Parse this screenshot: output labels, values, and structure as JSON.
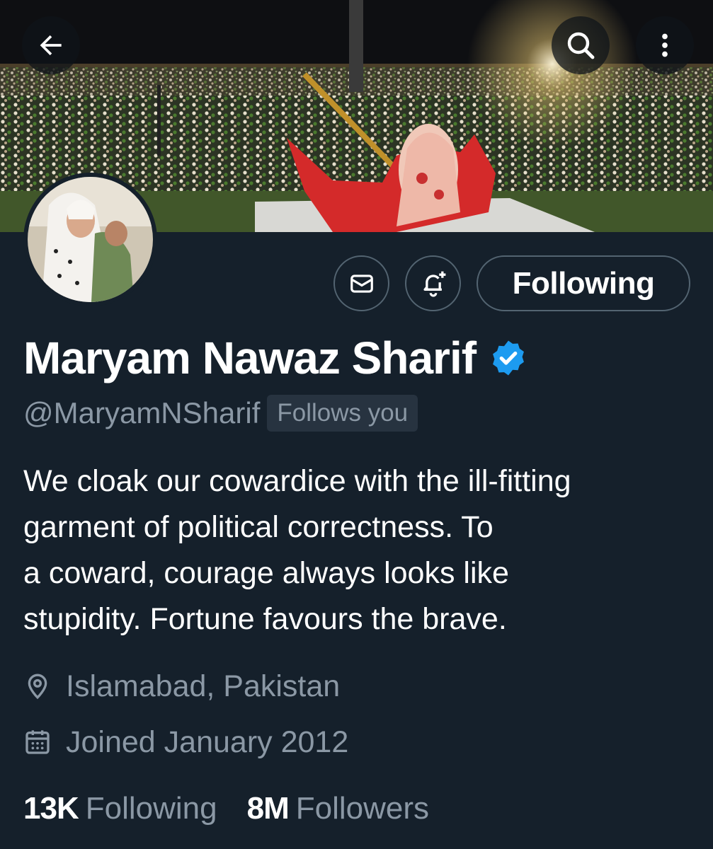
{
  "header": {
    "back_icon": "arrow-left-icon",
    "search_icon": "search-icon",
    "more_icon": "more-vertical-icon"
  },
  "profile": {
    "display_name": "Maryam Nawaz Sharif",
    "handle": "@MaryamNSharif",
    "follows_you": "Follows you",
    "bio": "We cloak our cowardice with the ill-fitting\ngarment of political correctness. To\na coward, courage always looks like\nstupidity. Fortune favours the brave.",
    "location": "Islamabad, Pakistan",
    "joined": "Joined January 2012",
    "verified_color": "#1d9bf0"
  },
  "actions": {
    "message_icon": "envelope-icon",
    "notify_icon": "bell-plus-icon",
    "following_label": "Following"
  },
  "stats": {
    "following_count": "13K",
    "following_label": "Following",
    "followers_count": "8M",
    "followers_label": "Followers"
  },
  "colors": {
    "background": "#15202b",
    "secondary_text": "#8b98a5",
    "border": "#536471"
  }
}
